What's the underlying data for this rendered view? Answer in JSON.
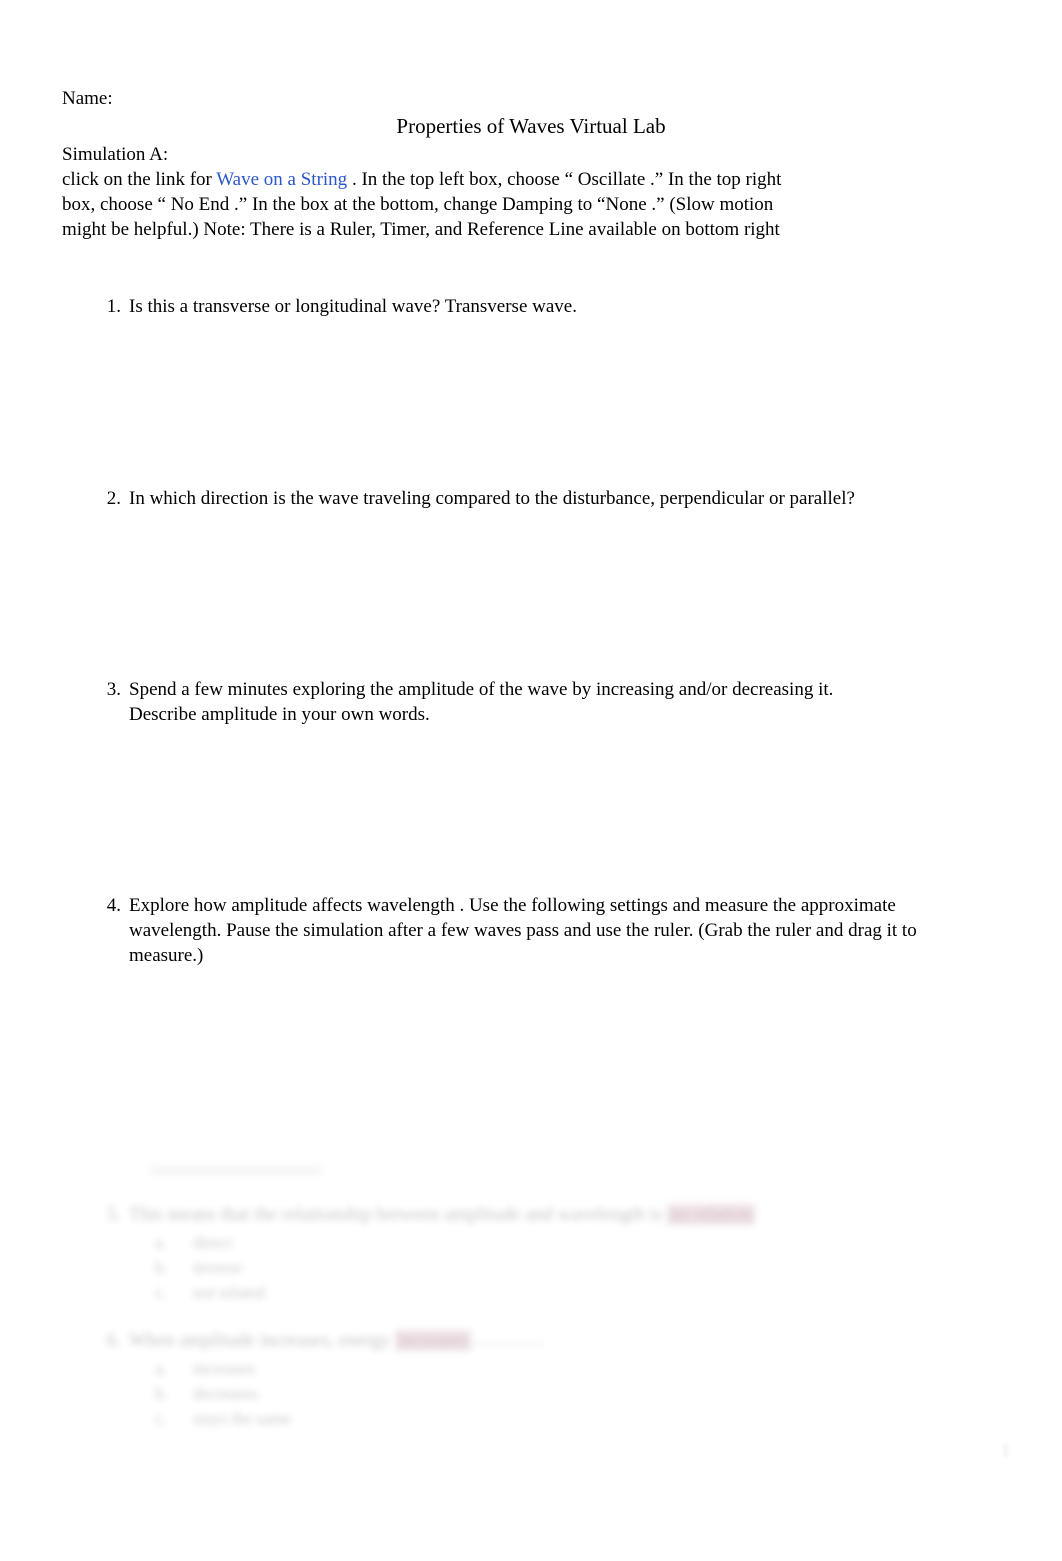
{
  "document": {
    "title": "Properties of Waves Virtual Lab",
    "name_field_label": "Name:",
    "section_label": "Simulation A:",
    "page_number": "1"
  },
  "link": {
    "label": "Wave on a String",
    "color": "#2B57C8"
  },
  "intro": {
    "before_link": "click on the link for ",
    "after_link": " . In the top left box, choose “    Oscillate  .” In the top right box, choose “   No End  .” In the box at the bottom, change Damping to “None .” (Slow motion might be helpful.) Note: There is a Ruler, Timer, and Reference Line available on bottom right"
  },
  "questions": [
    {
      "number": "1.",
      "text": "Is this a transverse or longitudinal wave? Transverse wave."
    },
    {
      "number": "2.",
      "text": "In which direction is the wave traveling compared to the disturbance, perpendicular or parallel?"
    },
    {
      "number": "3.",
      "text": "Spend a few minutes exploring the amplitude of the wave by increasing and/or decreasing it. Describe   amplitude    in your own words."
    },
    {
      "number": "4.",
      "text": "Explore how   amplitude    affects  wavelength   . Use the following settings and measure the approximate wavelength. Pause the simulation after a few waves pass and use the ruler. (Grab the ruler and drag it to measure.)"
    }
  ],
  "faded_questions": [
    {
      "number": "5.",
      "text_before_answer": "This means that the relationship between amplitude and wavelength is ",
      "answer": "no relation",
      "answer_highlight_color": "#c9a6b4",
      "options": [
        {
          "letter": "a.",
          "label": "direct"
        },
        {
          "letter": "b.",
          "label": "inverse"
        },
        {
          "letter": "c.",
          "label": "not related"
        }
      ]
    },
    {
      "number": "6.",
      "text_before_answer": "When amplitude increases, energy ",
      "answer": "increases",
      "answer_highlight_color": "#c9a6b4",
      "options": [
        {
          "letter": "a.",
          "label": "increases"
        },
        {
          "letter": "b.",
          "label": "decreases"
        },
        {
          "letter": "c.",
          "label": "stays the same"
        }
      ]
    }
  ]
}
